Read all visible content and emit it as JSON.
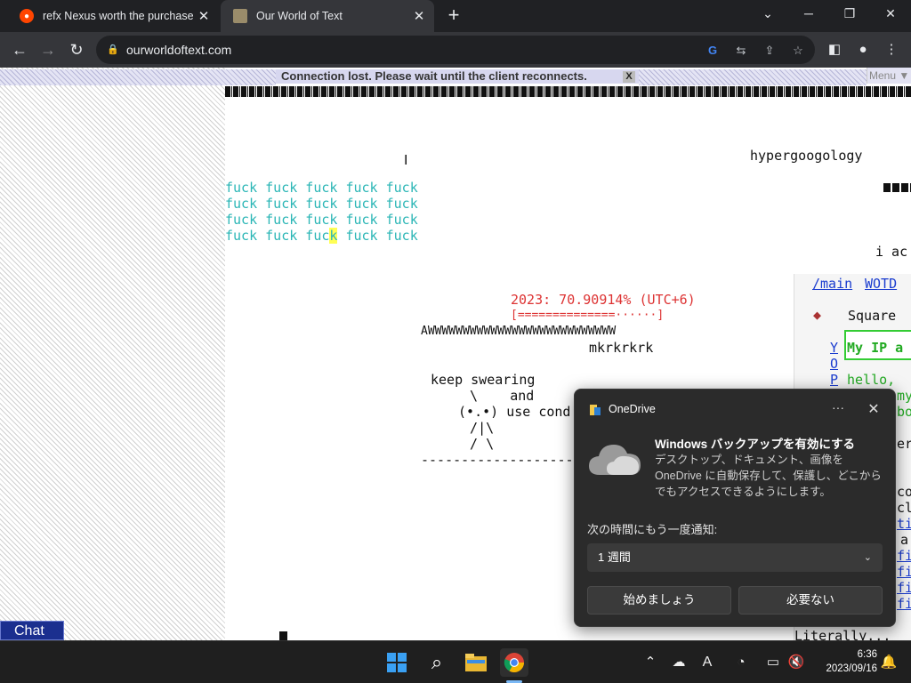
{
  "browser": {
    "tabs": [
      {
        "title": "refx Nexus worth the purchase? :",
        "active": false
      },
      {
        "title": "Our World of Text",
        "active": true
      }
    ],
    "new_tab_icon": "+",
    "window_controls": [
      "chevron-down-icon",
      "minimize-icon",
      "restore-icon",
      "close-icon"
    ],
    "url": "ourworldoftext.com"
  },
  "page": {
    "banner": "Connection lost. Please wait until the client reconnects.",
    "banner_close": "X",
    "menu_label": "Menu ▼",
    "lines": {
      "hyper": "hypergoogology",
      "fuck_line": "fuck fuck fuck fuck fuck",
      "fuck_line4a": "fuck fuck fuc",
      "fuck_highlight": "k",
      "fuck_line4b": " fuck fuck",
      "i_ac": "i ac",
      "progress_text": "2023: 70.90914% (UTC+6)",
      "progress_bar": "[==============······]",
      "aww": "AWWWWWWWWWWWWWWWWWWWWWWWWWWW",
      "mkr": "mkrkrkrk",
      "keep": "keep swearing",
      "art1": "  \\    and",
      "art2": " (•.•) use cond",
      "art3": "  /|\\",
      "art4": "  / \\",
      "dashes": "--------------------",
      "literally": "Literally..."
    },
    "side": {
      "link_main": "/main",
      "link_wotd": "WOTD",
      "square": "Square",
      "ip_box": "My IP a",
      "hello": "hello,",
      "left_links": [
        "Y",
        "O",
        "P"
      ],
      "partial_text": [
        "my",
        "boo",
        "er",
        "cor",
        "cle",
        "tim",
        "a",
        "fi",
        "fi",
        "fi",
        "fi"
      ]
    },
    "chat_label": "Chat"
  },
  "toast": {
    "app_name": "OneDrive",
    "more_icon": "···",
    "close_icon": "✕",
    "heading": "Windows バックアップを有効にする",
    "body": "デスクトップ、ドキュメント、画像を OneDrive に自動保存して、保護し、どこからでもアクセスできるようにします。",
    "remind_label": "次の時間にもう一度通知:",
    "remind_value": "1 週間",
    "primary_button": "始めましょう",
    "secondary_button": "必要ない"
  },
  "taskbar": {
    "time": "6:36",
    "date": "2023/09/16",
    "ime_indicator": "A"
  }
}
